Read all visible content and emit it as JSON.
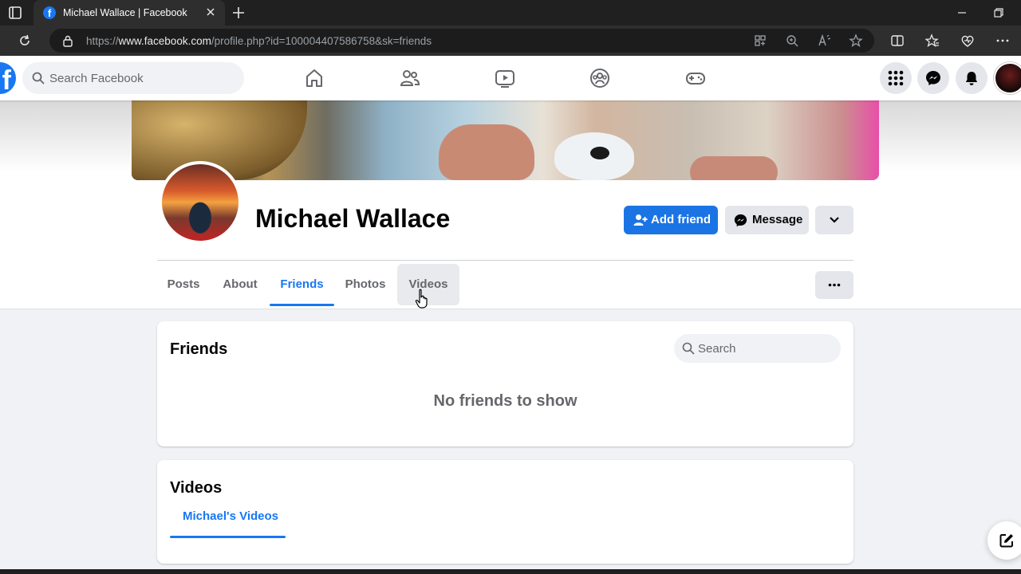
{
  "browser": {
    "tab_title": "Michael Wallace | Facebook",
    "url_prefix": "https://",
    "url_domain": "www.facebook.com",
    "url_path": "/profile.php?id=100004407586758&sk=friends"
  },
  "fb": {
    "search_placeholder": "Search Facebook",
    "nav_icons": [
      "home-icon",
      "friends-icon",
      "watch-icon",
      "groups-icon",
      "gaming-icon"
    ],
    "right_buttons": [
      "menu-grid-icon",
      "messenger-icon",
      "notifications-icon"
    ]
  },
  "profile": {
    "name": "Michael Wallace",
    "add_friend_label": "Add friend",
    "message_label": "Message",
    "tabs": [
      {
        "label": "Posts"
      },
      {
        "label": "About"
      },
      {
        "label": "Friends"
      },
      {
        "label": "Photos"
      },
      {
        "label": "Videos"
      }
    ],
    "active_tab": "Friends"
  },
  "friends_card": {
    "title": "Friends",
    "search_placeholder": "Search",
    "empty_text": "No friends to show"
  },
  "videos_card": {
    "title": "Videos",
    "tab_label": "Michael's Videos"
  },
  "colors": {
    "accent": "#1877f2",
    "chrome_dark": "#202020",
    "page_bg": "#f0f2f5"
  }
}
